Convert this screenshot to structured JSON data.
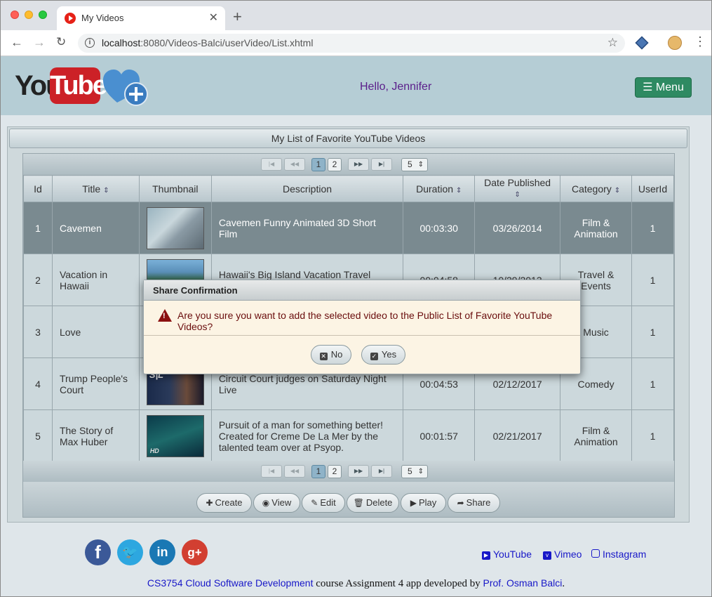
{
  "browser": {
    "tab_title": "My Videos",
    "url_host": "localhost",
    "url_rest": ":8080/Videos-Balci/userVideo/List.xhtml"
  },
  "header": {
    "logo_you": "You",
    "logo_tube": "Tube",
    "greeting": "Hello, Jennifer",
    "menu_label": "Menu"
  },
  "panel": {
    "title": "My List of Favorite YouTube Videos"
  },
  "pager": {
    "pages": [
      "1",
      "2"
    ],
    "active_page": "1",
    "rows_per_page": "5"
  },
  "table": {
    "columns": [
      "Id",
      "Title",
      "Thumbnail",
      "Description",
      "Duration",
      "Date Published",
      "Category",
      "UserId"
    ],
    "rows": [
      {
        "id": "1",
        "title": "Cavemen",
        "description": "Cavemen Funny Animated 3D Short Film",
        "duration": "00:03:30",
        "date": "03/26/2014",
        "category": "Film & Animation",
        "userid": "1"
      },
      {
        "id": "2",
        "title": "Vacation in Hawaii",
        "description": "Hawaii's Big Island Vacation Travel Guide",
        "duration": "00:04:58",
        "date": "10/29/2013",
        "category": "Travel & Events",
        "userid": "1"
      },
      {
        "id": "3",
        "title": "Love",
        "description": "",
        "duration": "",
        "date": "",
        "category": "Music",
        "userid": "1"
      },
      {
        "id": "4",
        "title": "Trump People's Court",
        "description": "Circuit Court judges on Saturday Night Live",
        "duration": "00:04:53",
        "date": "02/12/2017",
        "category": "Comedy",
        "userid": "1"
      },
      {
        "id": "5",
        "title": "The Story of Max Huber",
        "description": "Pursuit of a man for something better! Created for Creme De La Mer by the talented team over at Psyop.",
        "duration": "00:01:57",
        "date": "02/21/2017",
        "category": "Film & Animation",
        "userid": "1"
      }
    ],
    "thumb_labels": {
      "snl": "S|L",
      "hd": "HD"
    }
  },
  "toolbar": {
    "create": "Create",
    "view": "View",
    "edit": "Edit",
    "delete": "Delete",
    "play": "Play",
    "share": "Share"
  },
  "dialog": {
    "title": "Share Confirmation",
    "message": "Are you sure you want to add the selected video to the Public List of Favorite YouTube Videos?",
    "no_label": "No",
    "yes_label": "Yes"
  },
  "footer": {
    "links": [
      "YouTube",
      "Vimeo",
      "Instagram"
    ],
    "course_link": "CS3754 Cloud Software Development",
    "course_text": " course Assignment 4 app developed by ",
    "author_link": "Prof. Osman Balci",
    "end": "."
  },
  "colors": {
    "header_bg": "#b5cdd5",
    "menu_button": "#2e8a62",
    "selected_row": "#7a8a90",
    "dialog_bg": "#fcf4e4",
    "warning": "#8b1010"
  }
}
